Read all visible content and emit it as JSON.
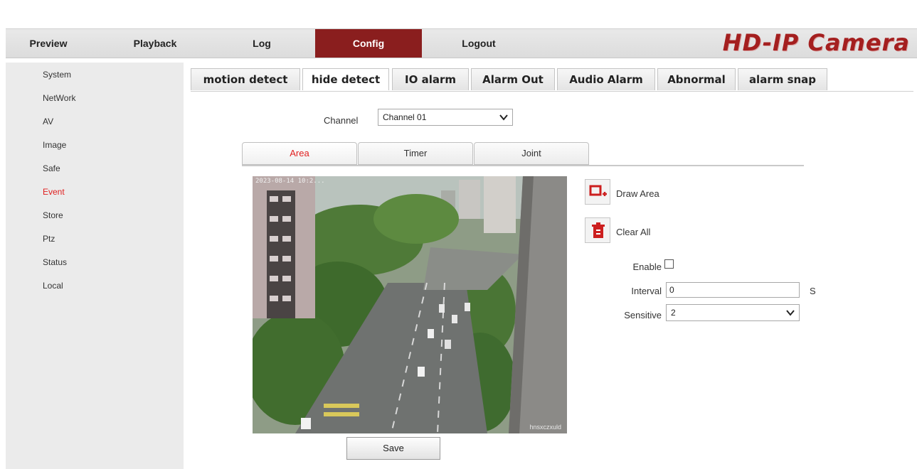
{
  "nav": {
    "items": [
      {
        "label": "Preview"
      },
      {
        "label": "Playback"
      },
      {
        "label": "Log"
      },
      {
        "label": "Config"
      },
      {
        "label": "Logout"
      }
    ],
    "active": "Config",
    "brand": "HD-IP Camera"
  },
  "sidebar": {
    "items": [
      {
        "label": "System"
      },
      {
        "label": "NetWork"
      },
      {
        "label": "AV"
      },
      {
        "label": "Image"
      },
      {
        "label": "Safe"
      },
      {
        "label": "Event"
      },
      {
        "label": "Store"
      },
      {
        "label": "Ptz"
      },
      {
        "label": "Status"
      },
      {
        "label": "Local"
      }
    ],
    "active": "Event"
  },
  "subtabs": {
    "items": [
      {
        "label": "motion detect"
      },
      {
        "label": "hide detect"
      },
      {
        "label": "IO alarm"
      },
      {
        "label": "Alarm Out"
      },
      {
        "label": "Audio Alarm"
      },
      {
        "label": "Abnormal"
      },
      {
        "label": "alarm snap"
      }
    ],
    "active": "hide detect"
  },
  "channel": {
    "label": "Channel",
    "value": "Channel 01"
  },
  "innertabs": {
    "items": [
      {
        "label": "Area"
      },
      {
        "label": "Timer"
      },
      {
        "label": "Joint"
      }
    ],
    "active": "Area"
  },
  "video": {
    "osd": "2023-08-14  10:2...",
    "watermark": "hnsxczxuld"
  },
  "tools": {
    "draw_label": "Draw Area",
    "clear_label": "Clear All"
  },
  "form": {
    "enable_label": "Enable",
    "enable_checked": false,
    "interval_label": "Interval",
    "interval_value": "0",
    "interval_unit": "S",
    "sensitive_label": "Sensitive",
    "sensitive_value": "2"
  },
  "save_label": "Save",
  "colors": {
    "accent": "#8a1e1e",
    "active_text": "#e02020",
    "brand": "#a41f1f"
  }
}
